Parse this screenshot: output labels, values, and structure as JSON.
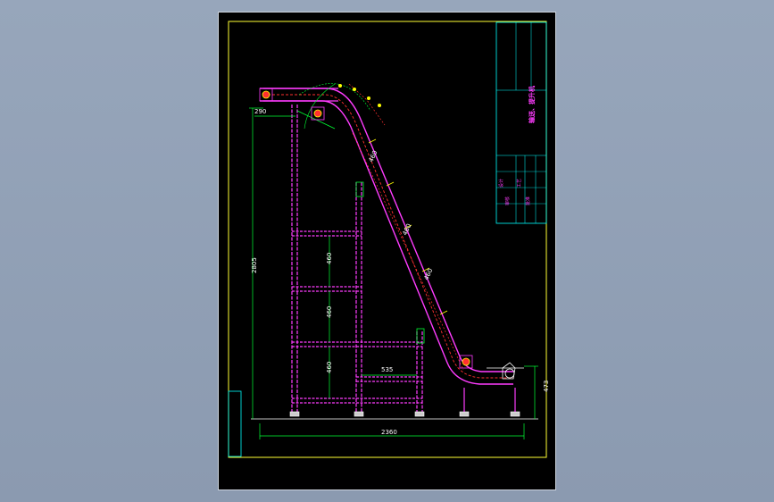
{
  "drawing": {
    "dimensions": {
      "top_offset": "290",
      "total_height": "2805",
      "tier_1": "460",
      "tier_2": "460",
      "tier_3": "460",
      "leg_spacing": "535",
      "total_length": "2360",
      "inlet_height": "473",
      "segment_a": "460",
      "segment_b": "460",
      "segment_c": "460"
    },
    "title_block": {
      "title": "输送、提升机",
      "rows": [
        "设计",
        "审核",
        "工艺",
        "批准"
      ]
    },
    "colors": {
      "background": "#8f9eb4",
      "sheet": "#000000",
      "frame": "#ffff33",
      "frame_inner": "#ffffff",
      "structure": "#ff3cff",
      "belt": "#ff3030",
      "dimension": "#00ff33",
      "ground": "#ffffff",
      "accent": "#ffff00"
    }
  }
}
